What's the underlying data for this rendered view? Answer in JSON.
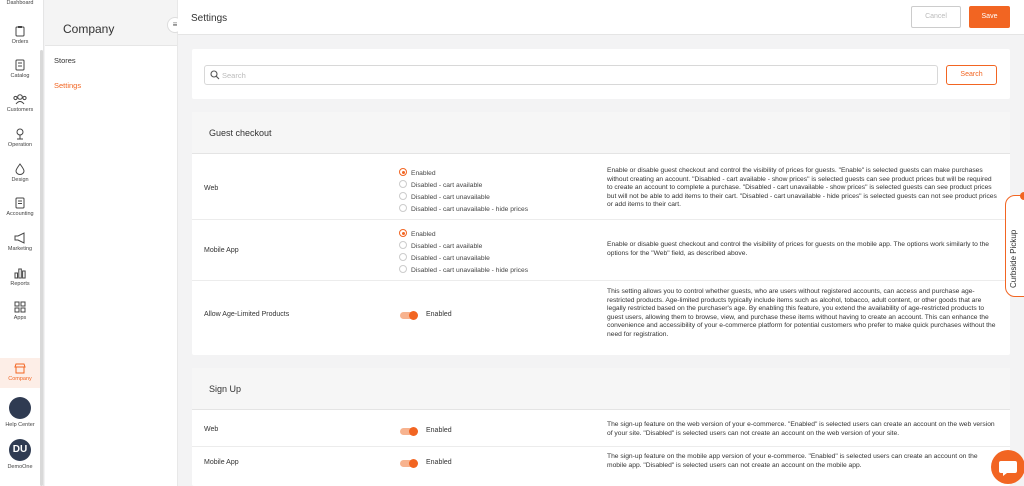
{
  "rail": {
    "items": [
      {
        "label": "Dashboard",
        "icon": "dashboard-icon"
      },
      {
        "label": "Orders",
        "icon": "clipboard-icon"
      },
      {
        "label": "Catalog",
        "icon": "catalog-icon"
      },
      {
        "label": "Customers",
        "icon": "users-icon"
      },
      {
        "label": "Operation",
        "icon": "operation-icon"
      },
      {
        "label": "Design",
        "icon": "droplet-icon"
      },
      {
        "label": "Accounting",
        "icon": "document-icon"
      },
      {
        "label": "Marketing",
        "icon": "megaphone-icon"
      },
      {
        "label": "Reports",
        "icon": "bar-chart-icon"
      },
      {
        "label": "Apps",
        "icon": "grid-icon"
      },
      {
        "label": "Company",
        "icon": "store-icon"
      },
      {
        "label": "Help Center",
        "icon": "help-avatar"
      },
      {
        "label": "DemoOne",
        "icon": "user-avatar",
        "initials": "DU"
      }
    ]
  },
  "subnav": {
    "title": "Company",
    "items": [
      {
        "label": "Stores"
      },
      {
        "label": "Settings"
      }
    ]
  },
  "header": {
    "title": "Settings",
    "cancel_label": "Cancel",
    "save_label": "Save"
  },
  "search": {
    "placeholder": "Search",
    "button_label": "Search"
  },
  "guest_checkout": {
    "title": "Guest checkout",
    "web": {
      "label": "Web",
      "options": [
        "Enabled",
        "Disabled - cart available",
        "Disabled - cart unavailable",
        "Disabled - cart unavailable - hide prices"
      ],
      "selected": "Enabled",
      "description": "Enable or disable guest checkout and control the visibility of prices for guests. \"Enable\" is selected guests can make purchases without creating an account. \"Disabled - cart available - show prices\" is selected guests can see product prices but will be required to create an account to complete a purchase. \"Disabled - cart unavailable - show prices\" is selected guests can see product prices but will not be able to add items to their cart. \"Disabled - cart unavailable - hide prices\" is selected guests can not see product prices or add items to their cart."
    },
    "mobile": {
      "label": "Mobile App",
      "options": [
        "Enabled",
        "Disabled - cart available",
        "Disabled - cart unavailable",
        "Disabled - cart unavailable - hide prices"
      ],
      "selected": "Enabled",
      "description": "Enable or disable guest checkout and control the visibility of prices for guests on the mobile app. The options work similarly to the options for the \"Web\" field, as described above."
    },
    "age_limited": {
      "label": "Allow Age-Limited Products",
      "toggle_label": "Enabled",
      "description": "This setting allows you to control whether guests, who are users without registered accounts, can access and purchase age-restricted products. Age-limited products typically include items such as alcohol, tobacco, adult content, or other goods that are legally restricted based on the purchaser's age. By enabling this feature, you extend the availability of age-restricted products to guest users, allowing them to browse, view, and purchase these items without having to create an account. This can enhance the convenience and accessibility of your e-commerce platform for potential customers who prefer to make quick purchases without the need for registration."
    }
  },
  "sign_up": {
    "title": "Sign Up",
    "web": {
      "label": "Web",
      "toggle_label": "Enabled",
      "description": "The sign-up feature on the web version of your e-commerce. \"Enabled\" is selected users can create an account on the web version of your site. \"Disabled\" is selected users can not create an account on the web version of your site."
    },
    "mobile": {
      "label": "Mobile App",
      "toggle_label": "Enabled",
      "description": "The sign-up feature on the mobile app version of your e-commerce. \"Enabled\" is selected users can create an account on the mobile app. \"Disabled\" is selected users can not create an account on the mobile app."
    }
  },
  "curbside": {
    "label": "Curbside Pickup"
  },
  "colors": {
    "accent": "#f26522",
    "toggle_track": "#f7b38f"
  }
}
